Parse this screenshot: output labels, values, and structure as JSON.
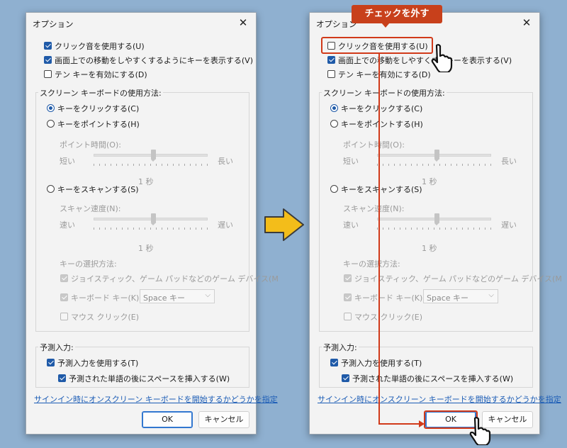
{
  "callout": "チェックを外す",
  "left": {
    "title": "オプション",
    "opt_click_sound": "クリック音を使用する(U)",
    "opt_show_keys": "画面上での移動をしやすくするようにキーを表示する(V)",
    "opt_numpad": "テン キーを有効にする(D)",
    "group_usage": "スクリーン キーボードの使用方法:",
    "radio_click": "キーをクリックする(C)",
    "radio_point": "キーをポイントする(H)",
    "point_time_label": "ポイント時間(O):",
    "short": "短い",
    "long": "長い",
    "one_sec": "1 秒",
    "radio_scan": "キーをスキャンする(S)",
    "scan_speed_label": "スキャン速度(N):",
    "fast": "速い",
    "slow": "遅い",
    "one_sec2": "1 秒",
    "key_select_label": "キーの選択方法:",
    "joystick": "ジョイスティック、ゲーム パッドなどのゲーム デバイス(M",
    "keyboard_key": "キーボード キー(K)",
    "select_value": "Space キー",
    "mouse_click": "マウス クリック(E)",
    "group_predict": "予測入力:",
    "use_predict": "予測入力を使用する(T)",
    "insert_space": "予測された単語の後にスペースを挿入する(W)",
    "signin_link": "サインイン時にオンスクリーン キーボードを開始するかどうかを指定",
    "ok": "OK",
    "cancel": "キャンセル"
  },
  "right": {
    "title": "オプション",
    "opt_click_sound": "クリック音を使用する(U)",
    "opt_show_keys_a": "画面上での移動をしやすくす",
    "opt_show_keys_b": "キーを表示する(V)",
    "opt_numpad": "テン キーを有効にする(D)",
    "group_usage": "スクリーン キーボードの使用方法:",
    "radio_click": "キーをクリックする(C)",
    "radio_point": "キーをポイントする(H)",
    "point_time_label": "ポイント時間(O):",
    "short": "短い",
    "long": "長い",
    "one_sec": "1 秒",
    "radio_scan": "キーをスキャンする(S)",
    "scan_speed_label": "スキャン速度(N):",
    "fast": "速い",
    "slow": "遅い",
    "one_sec2": "1 秒",
    "key_select_label": "キーの選択方法:",
    "joystick": "ジョイスティック、ゲーム パッドなどのゲーム デバイス(M",
    "keyboard_key": "キーボード キー(K)",
    "select_value": "Space キー",
    "mouse_click": "マウス クリック(E)",
    "group_predict": "予測入力:",
    "use_predict": "予測入力を使用する(T)",
    "insert_space": "予測された単語の後にスペースを挿入する(W)",
    "signin_link": "サインイン時にオンスクリーン キーボードを開始するかどうかを指定",
    "ok": "OK",
    "cancel": "キャンセル"
  },
  "colors": {
    "accent": "#1f5aa8",
    "highlight": "#d13a1a",
    "callout": "#c8401b",
    "arrow": "#f3bd1a"
  }
}
